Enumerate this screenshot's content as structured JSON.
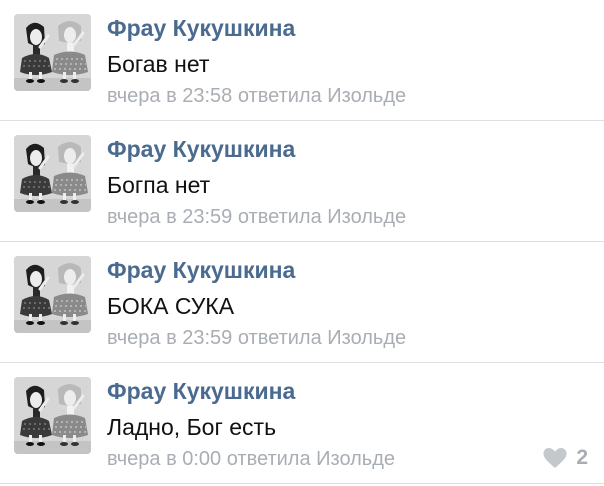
{
  "colors": {
    "author": "#4a6a8f",
    "text": "#111111",
    "meta": "#a9aeb4",
    "divider": "#dcdfe3"
  },
  "comments": [
    {
      "author": "Фрау Кукушкина",
      "text": "Богав нет",
      "time": "вчера в 23:58",
      "reply": "ответила Изольде"
    },
    {
      "author": "Фрау Кукушкина",
      "text": "Богпа нет",
      "time": "вчера в 23:59",
      "reply": "ответила Изольде"
    },
    {
      "author": "Фрау Кукушкина",
      "text": "БОКА СУКА",
      "time": "вчера в 23:59",
      "reply": "ответила Изольде"
    },
    {
      "author": "Фрау Кукушкина",
      "text": "Ладно, Бог есть",
      "time": "вчера в 0:00",
      "reply": "ответила Изольде",
      "like_icon": "heart-icon",
      "likes": "2"
    }
  ]
}
